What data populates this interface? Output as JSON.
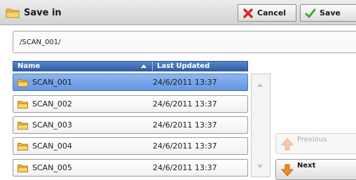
{
  "header": {
    "title": "Save in",
    "cancel_label": "Cancel",
    "save_label": "Save"
  },
  "path": "/SCAN_001/",
  "columns": {
    "name": "Name",
    "updated": "Last Updated",
    "sort": "ascending"
  },
  "files": [
    {
      "name": "SCAN_001",
      "updated": "24/6/2011 13:37",
      "selected": true
    },
    {
      "name": "SCAN_002",
      "updated": "24/6/2011 13:37",
      "selected": false
    },
    {
      "name": "SCAN_003",
      "updated": "24/6/2011 13:37",
      "selected": false
    },
    {
      "name": "SCAN_004",
      "updated": "24/6/2011 13:37",
      "selected": false
    },
    {
      "name": "SCAN_005",
      "updated": "24/6/2011 13:37",
      "selected": false
    }
  ],
  "nav": {
    "previous_label": "Previous",
    "next_label": "Next",
    "previous_enabled": false,
    "next_enabled": true
  },
  "icons": {
    "folder": "folder-icon",
    "cancel": "red-x-icon",
    "save": "green-check-icon",
    "previous": "up-arrow-icon",
    "next": "down-arrow-icon"
  },
  "colors": {
    "selected_row": "#6f9fe6",
    "column_header": "#3b68b0",
    "folder": "#f5c542",
    "nav_arrow": "#f08a24"
  }
}
